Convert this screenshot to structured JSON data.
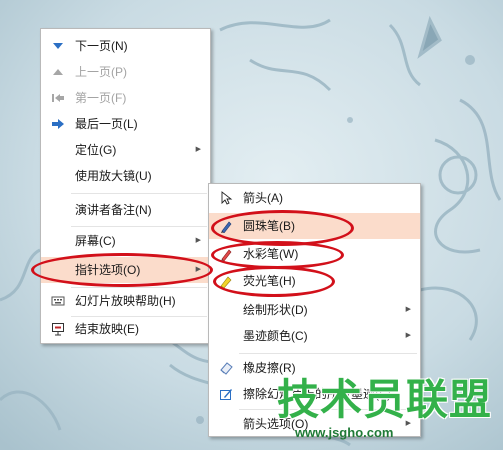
{
  "main_menu": [
    {
      "label": "下一页(N)",
      "icon": "arrow-down-icon",
      "disabled": false
    },
    {
      "label": "上一页(P)",
      "icon": "arrow-up-icon",
      "disabled": true
    },
    {
      "label": "第一页(F)",
      "icon": "first-page-icon",
      "disabled": true
    },
    {
      "label": "最后一页(L)",
      "icon": "last-page-icon",
      "disabled": false
    },
    {
      "label": "定位(G)",
      "submenu": true
    },
    {
      "label": "使用放大镜(U)"
    },
    {
      "label": "演讲者备注(N)"
    },
    {
      "label": "屏幕(C)",
      "submenu": true
    },
    {
      "label": "指针选项(O)",
      "submenu": true,
      "highlighted": true
    },
    {
      "label": "幻灯片放映帮助(H)",
      "icon": "keyboard-help-icon"
    },
    {
      "label": "结束放映(E)",
      "icon": "end-show-icon"
    }
  ],
  "sub_menu": [
    {
      "label": "箭头(A)",
      "icon": "cursor-arrow-icon"
    },
    {
      "label": "圆珠笔(B)",
      "icon": "ballpoint-pen-icon",
      "highlighted": true
    },
    {
      "label": "水彩笔(W)",
      "icon": "watercolor-pen-icon"
    },
    {
      "label": "荧光笔(H)",
      "icon": "highlighter-icon"
    },
    {
      "label": "绘制形状(D)",
      "submenu": true
    },
    {
      "label": "墨迹颜色(C)",
      "submenu": true
    },
    {
      "label": "橡皮擦(R)",
      "icon": "eraser-icon"
    },
    {
      "label": "擦除幻灯片上的所有墨迹(E)",
      "icon": "erase-all-icon"
    },
    {
      "label": "箭头选项(O)",
      "submenu": true
    }
  ],
  "watermark": {
    "title": "技术员联盟",
    "url": "www.jsgho.com"
  },
  "colors": {
    "highlight": "#fbdccb",
    "annotation_oval": "#d2101a",
    "watermark": "#33b14a"
  }
}
